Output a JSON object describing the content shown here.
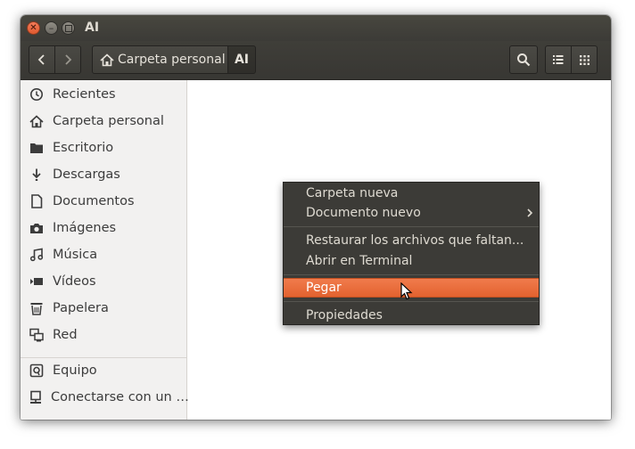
{
  "window": {
    "title": "AI"
  },
  "toolbar": {
    "breadcrumb_home": "Carpeta personal",
    "breadcrumb_current": "AI"
  },
  "sidebar": {
    "items": [
      {
        "label": "Recientes",
        "icon": "clock-icon"
      },
      {
        "label": "Carpeta personal",
        "icon": "home-icon"
      },
      {
        "label": "Escritorio",
        "icon": "folder-icon"
      },
      {
        "label": "Descargas",
        "icon": "download-icon"
      },
      {
        "label": "Documentos",
        "icon": "document-icon"
      },
      {
        "label": "Imágenes",
        "icon": "camera-icon"
      },
      {
        "label": "Música",
        "icon": "music-icon"
      },
      {
        "label": "Vídeos",
        "icon": "video-icon"
      },
      {
        "label": "Papelera",
        "icon": "trash-icon"
      },
      {
        "label": "Red",
        "icon": "network-icon"
      },
      {
        "label": "Equipo",
        "icon": "drive-icon"
      },
      {
        "label": "Conectarse con un …",
        "icon": "server-icon"
      }
    ]
  },
  "context_menu": {
    "items": [
      {
        "label": "Carpeta nueva"
      },
      {
        "label": "Documento nuevo"
      },
      {
        "label": "Restaurar los archivos que faltan..."
      },
      {
        "label": "Abrir en Terminal"
      },
      {
        "label": "Pegar"
      },
      {
        "label": "Propiedades"
      }
    ],
    "highlight_color": "#e95420"
  },
  "colors": {
    "titlebar": "#3c3b37",
    "accent": "#e95420",
    "sidebar_bg": "#f2f1f0"
  }
}
